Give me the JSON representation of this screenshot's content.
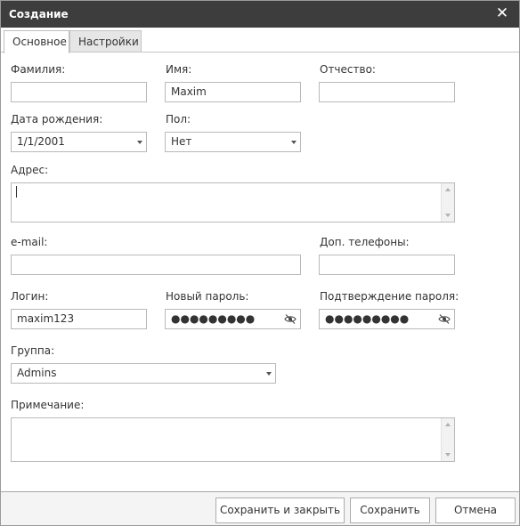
{
  "window": {
    "title": "Создание",
    "close_glyph": "✕"
  },
  "tabs": [
    {
      "label": "Основное",
      "active": true
    },
    {
      "label": "Настройки",
      "active": false
    }
  ],
  "form": {
    "last_name": {
      "label": "Фамилия:",
      "value": ""
    },
    "first_name": {
      "label": "Имя:",
      "value": "Maxim"
    },
    "middle_name": {
      "label": "Отчество:",
      "value": ""
    },
    "birth_date": {
      "label": "Дата рождения:",
      "value": "1/1/2001"
    },
    "gender": {
      "label": "Пол:",
      "value": "Нет"
    },
    "address": {
      "label": "Адрес:",
      "value": ""
    },
    "email": {
      "label": "e-mail:",
      "value": ""
    },
    "extra_phones": {
      "label": "Доп. телефоны:",
      "value": ""
    },
    "login": {
      "label": "Логин:",
      "value": "maxim123"
    },
    "new_password": {
      "label": "Новый пароль:",
      "masked": "●●●●●●●●●"
    },
    "confirm_password": {
      "label": "Подтверждение пароля:",
      "masked": "●●●●●●●●●"
    },
    "group": {
      "label": "Группа:",
      "value": "Admins"
    },
    "note": {
      "label": "Примечание:",
      "value": ""
    }
  },
  "buttons": {
    "save_close": "Сохранить и закрыть",
    "save": "Сохранить",
    "cancel": "Отмена"
  },
  "icons": {
    "close": "close-icon",
    "dropdown": "chevron-down-icon",
    "show_password": "eye-slash-icon",
    "scroll_up": "scroll-up-icon",
    "scroll_down": "scroll-down-icon"
  },
  "colors": {
    "titlebar": "#3d3d3d",
    "border": "#b9b9b9",
    "text": "#333333",
    "inactive_tab": "#e6e6e6"
  }
}
